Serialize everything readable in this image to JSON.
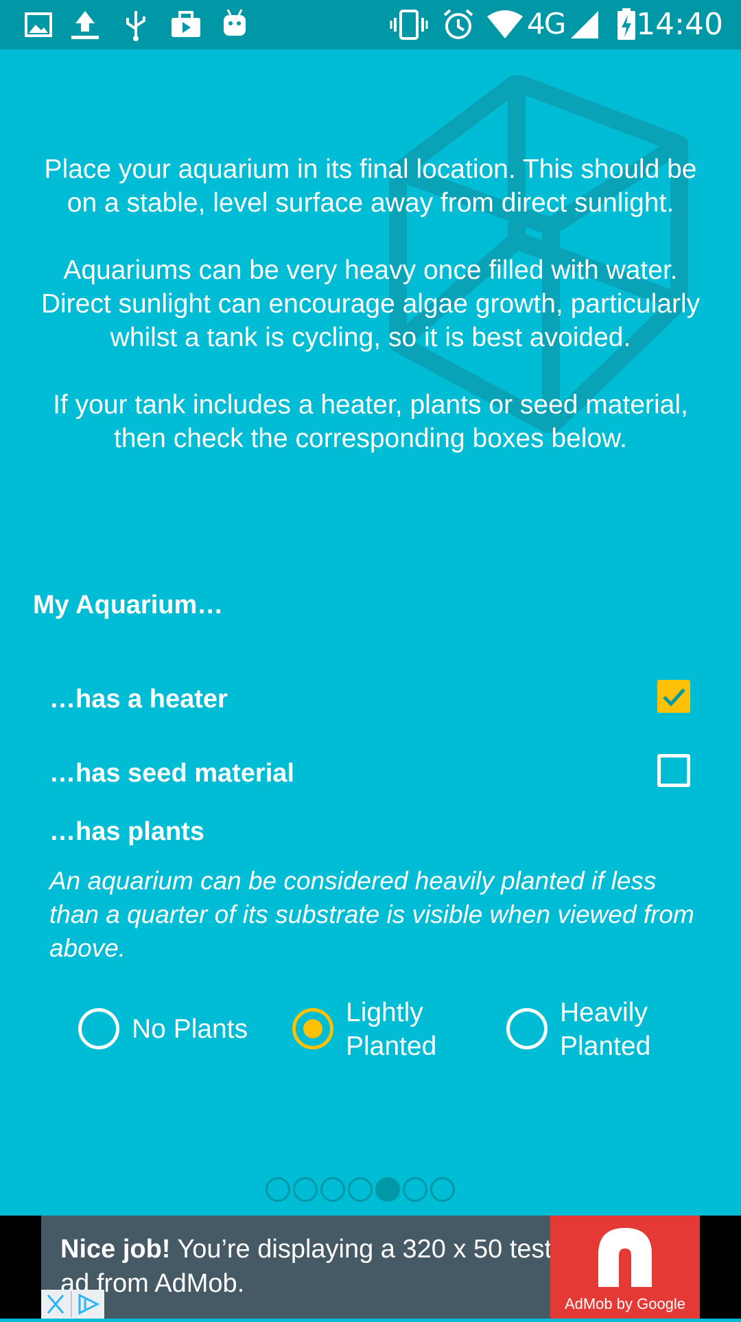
{
  "status_bar": {
    "network": "4G",
    "time": "14:40",
    "icons": [
      "image-icon",
      "upload-icon",
      "usb-icon",
      "briefcase-icon",
      "android-icon",
      "vibrate-icon",
      "alarm-icon",
      "wifi-icon",
      "signal-icon",
      "battery-charging-icon"
    ]
  },
  "intro": {
    "paragraphs": [
      "Place your aquarium in its final location. This should be on a stable, level surface away from direct sunlight.",
      "Aquariums can be very heavy once filled with water. Direct sunlight can encourage algae growth, particularly whilst a tank is cycling, so it is best avoided.",
      "If your tank includes a heater, plants or seed material, then check the corresponding boxes below."
    ]
  },
  "form": {
    "title": "My Aquarium…",
    "heater": {
      "label": "…has a heater",
      "checked": true
    },
    "seed": {
      "label": "…has seed material",
      "checked": false
    },
    "plants": {
      "title": "…has plants",
      "note": "An aquarium can be considered heavily planted if less than a quarter of its substrate is visible when viewed from above.",
      "options": [
        {
          "line1": "No Plants",
          "line2": "",
          "selected": false
        },
        {
          "line1": "Lightly",
          "line2": "Planted",
          "selected": true
        },
        {
          "line1": "Heavily",
          "line2": "Planted",
          "selected": false
        }
      ]
    }
  },
  "pager": {
    "total": 7,
    "active": 5
  },
  "ad": {
    "bold": "Nice job!",
    "text": " You’re displaying a 320 x 50 test ad from AdMob.",
    "brand": "AdMob by Google"
  },
  "colors": {
    "background": "#00bcd4",
    "status_bar": "#0097a7",
    "accent": "#ffc107",
    "ad_background": "#455a64",
    "ad_logo": "#e53935"
  }
}
